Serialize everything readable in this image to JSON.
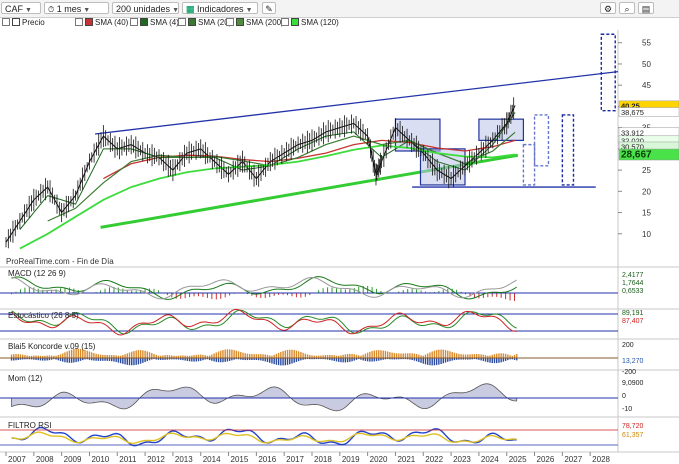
{
  "toolbar": {
    "symbol": "CAF",
    "period": "1 mes",
    "units": "200 unidades",
    "indicators_label": "Indicadores"
  },
  "legend": [
    {
      "label": "Precio",
      "color": "#ffffff"
    },
    {
      "label": "SMA (40)",
      "color": "#c83232"
    },
    {
      "label": "SMA (4)",
      "color": "#1e6a1e"
    },
    {
      "label": "SMA (20)",
      "color": "#3a7a30"
    },
    {
      "label": "SMA (200)",
      "color": "#4c8c3c"
    },
    {
      "label": "SMA (120)",
      "color": "#3cdc3c"
    }
  ],
  "source_text": "ProRealTime.com - Fin de Día",
  "panels": {
    "macd": {
      "title": "MACD (12 26 9)",
      "values": [
        "2,4177",
        "1,7644",
        "0,6533"
      ]
    },
    "stoch": {
      "title": "Estocástico (26 8 5)",
      "values": [
        "89,191",
        "87,407"
      ]
    },
    "konc": {
      "title": "Blai5 Koncorde v.09 (15)",
      "values": [
        "200",
        "13,270",
        "-200"
      ]
    },
    "mom": {
      "title": "Mom (12)",
      "values": [
        "9,0900",
        "0",
        "-10"
      ]
    },
    "rsi": {
      "title": "FILTRO RSI",
      "values": [
        "78,720",
        "61,357"
      ]
    }
  },
  "chart_data": {
    "type": "line",
    "title": "CAF",
    "x_range": [
      2007,
      2029
    ],
    "ylim": [
      5,
      58
    ],
    "y_ticks": [
      55,
      50,
      45,
      40,
      35,
      30,
      25,
      20,
      15,
      10
    ],
    "x_ticks": [
      "2007",
      "2008",
      "2009",
      "2010",
      "2011",
      "2012",
      "2013",
      "2014",
      "2015",
      "2016",
      "2017",
      "2018",
      "2019",
      "2020",
      "2021",
      "2022",
      "2023",
      "2024",
      "2025",
      "2026",
      "2027",
      "2028"
    ],
    "price_tags": [
      {
        "label": "40,25",
        "value": 40.25,
        "color": "#ffd400"
      },
      {
        "label": "38,675",
        "value": 38.675,
        "color": "#ffffff"
      },
      {
        "label": "33,912",
        "value": 33.912,
        "color": "#ffffff"
      },
      {
        "label": "32,020",
        "value": 32.02,
        "color": "#eaffea"
      },
      {
        "label": "30,570",
        "value": 30.57,
        "color": "#d8f6d8"
      },
      {
        "label": "28,667",
        "value": 28.667,
        "color": "#49e349"
      }
    ],
    "series": [
      {
        "name": "Precio",
        "x": [
          2007.0,
          2007.5,
          2008.0,
          2008.5,
          2009.0,
          2009.5,
          2010.0,
          2010.5,
          2011.0,
          2011.5,
          2012.0,
          2012.5,
          2013.0,
          2013.5,
          2014.0,
          2014.5,
          2015.0,
          2015.5,
          2016.0,
          2016.5,
          2017.0,
          2017.5,
          2018.0,
          2018.5,
          2019.0,
          2019.5,
          2020.0,
          2020.3,
          2020.5,
          2021.0,
          2021.5,
          2022.0,
          2022.5,
          2023.0,
          2023.5,
          2024.0,
          2024.5,
          2025.0,
          2025.3
        ],
        "y": [
          8,
          13,
          18,
          21,
          15,
          19,
          27,
          33,
          30,
          31,
          29,
          28,
          25,
          29,
          30,
          27,
          24,
          27,
          23,
          27,
          29,
          31,
          32,
          34,
          35,
          36,
          33,
          24,
          27,
          35,
          32,
          29,
          25,
          23,
          26,
          29,
          32,
          36,
          40.25
        ]
      },
      {
        "name": "SMA (40)",
        "x": [
          2010.5,
          2011.5,
          2012.5,
          2013.5,
          2014.5,
          2015.5,
          2016.5,
          2017.5,
          2018.5,
          2019.5,
          2020.5,
          2021.5,
          2022.5,
          2023.5,
          2024.5,
          2025.3
        ],
        "y": [
          23,
          26.5,
          28,
          28.5,
          28.3,
          27.5,
          27,
          27.8,
          29,
          31,
          32,
          31.5,
          30.2,
          29.5,
          30.5,
          32
        ]
      },
      {
        "name": "SMA (4)",
        "x": [
          2007.5,
          2008.5,
          2009.5,
          2010.5,
          2011.5,
          2012.5,
          2013.5,
          2014.5,
          2015.5,
          2016.5,
          2017.5,
          2018.5,
          2019.5,
          2020.5,
          2021.5,
          2022.5,
          2023.5,
          2024.5,
          2025.3
        ],
        "y": [
          11,
          19,
          17,
          30,
          30,
          28,
          28,
          28,
          25,
          26,
          30,
          33,
          34,
          28,
          32,
          27,
          25,
          31,
          38.6
        ]
      },
      {
        "name": "SMA (20)",
        "x": [
          2008.5,
          2009.5,
          2010.5,
          2011.5,
          2012.5,
          2013.5,
          2014.5,
          2015.5,
          2016.5,
          2017.5,
          2018.5,
          2019.5,
          2020.5,
          2021.5,
          2022.5,
          2023.5,
          2024.5,
          2025.3
        ],
        "y": [
          13,
          16,
          22,
          27,
          28.5,
          28,
          28.2,
          27.2,
          26,
          28,
          31,
          33,
          31,
          32,
          29,
          26.5,
          29.5,
          33.9
        ]
      },
      {
        "name": "SMA (120)",
        "x": [
          2007.5,
          2008.5,
          2009.5,
          2010.5,
          2011.5,
          2012.5,
          2013.5,
          2014.5,
          2015.5,
          2016.5,
          2017.5,
          2018.5,
          2019.5,
          2020.5,
          2021.5,
          2022.5,
          2023.5,
          2024.5,
          2025.3
        ],
        "y": [
          6.5,
          10,
          14,
          18,
          21,
          23,
          24.5,
          25.4,
          25.8,
          26.2,
          27,
          28.3,
          29.8,
          30.8,
          30.2,
          29,
          28.2,
          28,
          28.667
        ]
      },
      {
        "name": "SMA (200)",
        "x": [
          2010.4,
          2012.5,
          2014.5,
          2016.5,
          2018.5,
          2020.0,
          2021.5,
          2023.0,
          2024.5,
          2025.3
        ],
        "y": [
          11.5,
          14.5,
          17.5,
          20.5,
          23.5,
          25.2,
          26.2,
          27,
          28,
          28.5
        ]
      }
    ]
  }
}
